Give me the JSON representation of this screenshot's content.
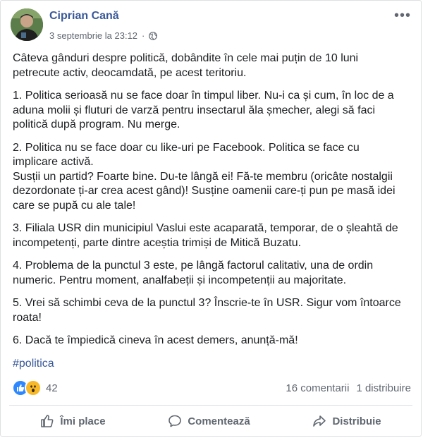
{
  "post": {
    "author": "Ciprian Cană",
    "timestamp": "3 septembrie la 23:12",
    "privacy_icon": "globe-icon",
    "menu_icon": "•••",
    "paragraphs": [
      "Câteva gânduri despre politică, dobândite în cele mai puțin de 10 luni\npetrecute activ, deocamdată, pe acest teritoriu.",
      "1. Politica serioasă nu se face doar în timpul liber. Nu-i ca și cum, în loc de a\naduna molii și fluturi de varză pentru insectarul ăla șmecher, alegi să faci\npolitică după program. Nu merge.",
      "2. Politica nu se face doar cu like-uri pe Facebook. Politica se face cu\nimplicare activă.\nSusții un partid? Foarte bine. Du-te lângă ei! Fă-te membru (oricâte nostalgii\ndezordonate ți-ar crea acest gând)! Susține oamenii care-ți pun pe masă idei\ncare se pupă cu ale tale!",
      "3. Filiala USR din municipiul Vaslui este acaparată, temporar, de o șleahtă de\nincompetenți, parte dintre aceștia trimiși de Mitică Buzatu.",
      "4. Problema de la punctul 3 este, pe lângă factorul calitativ, una de ordin\nnumeric. Pentru moment, analfabeții și incompetenții au majoritate.",
      "5. Vrei să schimbi ceva de la punctul 3? Înscrie-te în USR. Sigur vom întoarce\nroata!",
      "6. Dacă te împiedică cineva în acest demers, anunță-mă!"
    ],
    "hashtag": "#politica"
  },
  "stats": {
    "reaction_count": "42",
    "reaction_icons": [
      "like-reaction-icon",
      "wow-reaction-icon"
    ],
    "comments": "16 comentarii",
    "shares": "1 distribuire"
  },
  "actions": {
    "like": "Îmi place",
    "comment": "Comentează",
    "share": "Distribuie"
  },
  "colors": {
    "author_link": "#385898",
    "meta_text": "#606770",
    "like_blue": "#2d88ff",
    "wow_yellow": "#f7b928"
  }
}
